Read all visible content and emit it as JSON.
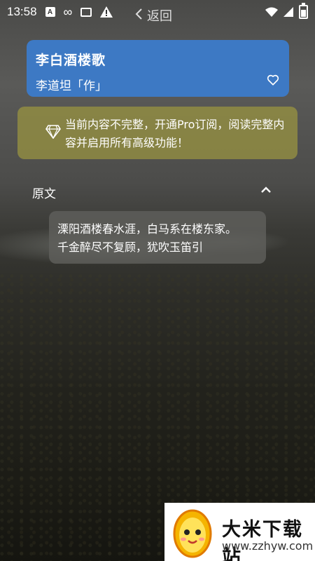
{
  "status_bar": {
    "time": "13:58",
    "icons": [
      "text-a-icon",
      "infinity-icon",
      "tray-icon",
      "warning-icon",
      "wifi-icon",
      "signal-icon",
      "battery-icon"
    ]
  },
  "nav": {
    "back_label": "返回"
  },
  "poem": {
    "title": "李白酒楼歌",
    "author": "李道坦「作」",
    "favorite_icon": "heart-outline-icon"
  },
  "notice": {
    "text": "当前内容不完整，开通Pro订阅，阅读完整内容并启用所有高级功能！",
    "icon": "diamond-icon"
  },
  "section": {
    "title": "原文",
    "toggle_icon": "chevron-up-icon"
  },
  "original_text": {
    "line1": "溧阳酒楼春水涯，白马系在楼东家。",
    "line2": "千金醉尽不复顾，犹吹玉笛引"
  },
  "watermark": {
    "name": "大米下载站",
    "url": "www.zzhyw.com"
  },
  "colors": {
    "title_card": "#3d79c4",
    "notice_bg": "#96913f",
    "poem_box_bg": "#5f5f5c"
  }
}
